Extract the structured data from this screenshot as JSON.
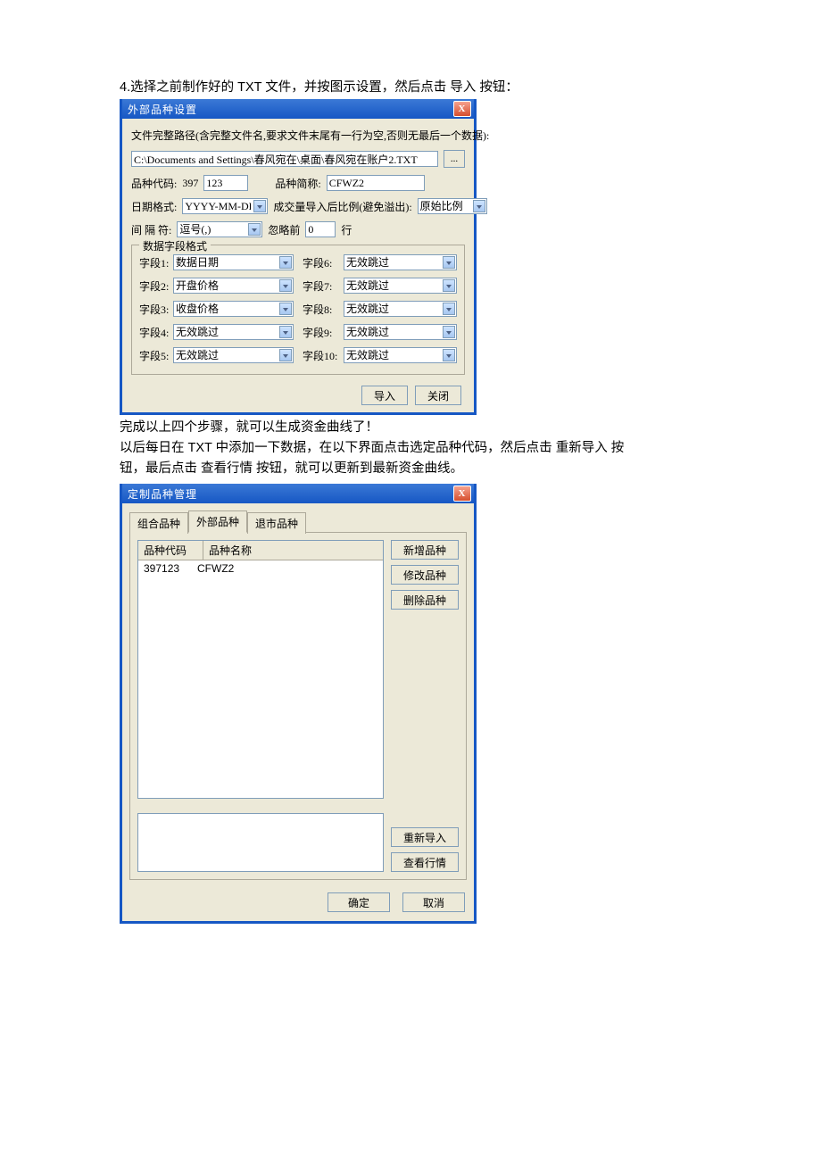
{
  "doc": {
    "line1": "4.选择之前制作好的 TXT 文件，并按图示设置，然后点击 导入 按钮：",
    "line2": "完成以上四个步骤，就可以生成资金曲线了！",
    "line3": "以后每日在 TXT 中添加一下数据，在以下界面点击选定品种代码，然后点击 重新导入 按",
    "line4": "钮，最后点击  查看行情 按钮，就可以更新到最新资金曲线。"
  },
  "dlg1": {
    "title": "外部品种设置",
    "close": "X",
    "path_label": "文件完整路径(含完整文件名,要求文件末尾有一行为空,否则无最后一个数据):",
    "path_value": "C:\\Documents and Settings\\春风宛在\\桌面\\春风宛在账户2.TXT",
    "browse": "...",
    "code_label": "品种代码:",
    "code_prefix": "397",
    "code_value": "123",
    "name_label": "品种简称:",
    "name_value": "CFWZ2",
    "date_label": "日期格式:",
    "date_value": "YYYY-MM-DD",
    "ratio_label": "成交量导入后比例(避免溢出):",
    "ratio_value": "原始比例",
    "sep_label": "间 隔 符:",
    "sep_value": "逗号(,)",
    "skip_pre": "忽略前",
    "skip_value": "0",
    "skip_post": "行",
    "group_title": "数据字段格式",
    "fields_left": [
      {
        "label": "字段1:",
        "value": "数据日期"
      },
      {
        "label": "字段2:",
        "value": "开盘价格"
      },
      {
        "label": "字段3:",
        "value": "收盘价格"
      },
      {
        "label": "字段4:",
        "value": "无效跳过"
      },
      {
        "label": "字段5:",
        "value": "无效跳过"
      }
    ],
    "fields_right": [
      {
        "label": "字段6:",
        "value": "无效跳过"
      },
      {
        "label": "字段7:",
        "value": "无效跳过"
      },
      {
        "label": "字段8:",
        "value": "无效跳过"
      },
      {
        "label": "字段9:",
        "value": "无效跳过"
      },
      {
        "label": "字段10:",
        "value": "无效跳过"
      }
    ],
    "btn_import": "导入",
    "btn_close": "关闭"
  },
  "dlg2": {
    "title": "定制品种管理",
    "close": "X",
    "tabs": {
      "t1": "组合品种",
      "t2": "外部品种",
      "t3": "退市品种"
    },
    "list_head": {
      "code": "品种代码",
      "name": "品种名称"
    },
    "list_row": {
      "code": "397123",
      "name": "CFWZ2"
    },
    "btn_new": "新增品种",
    "btn_edit": "修改品种",
    "btn_del": "删除品种",
    "btn_reimport": "重新导入",
    "btn_view": "查看行情",
    "btn_ok": "确定",
    "btn_cancel": "取消"
  }
}
